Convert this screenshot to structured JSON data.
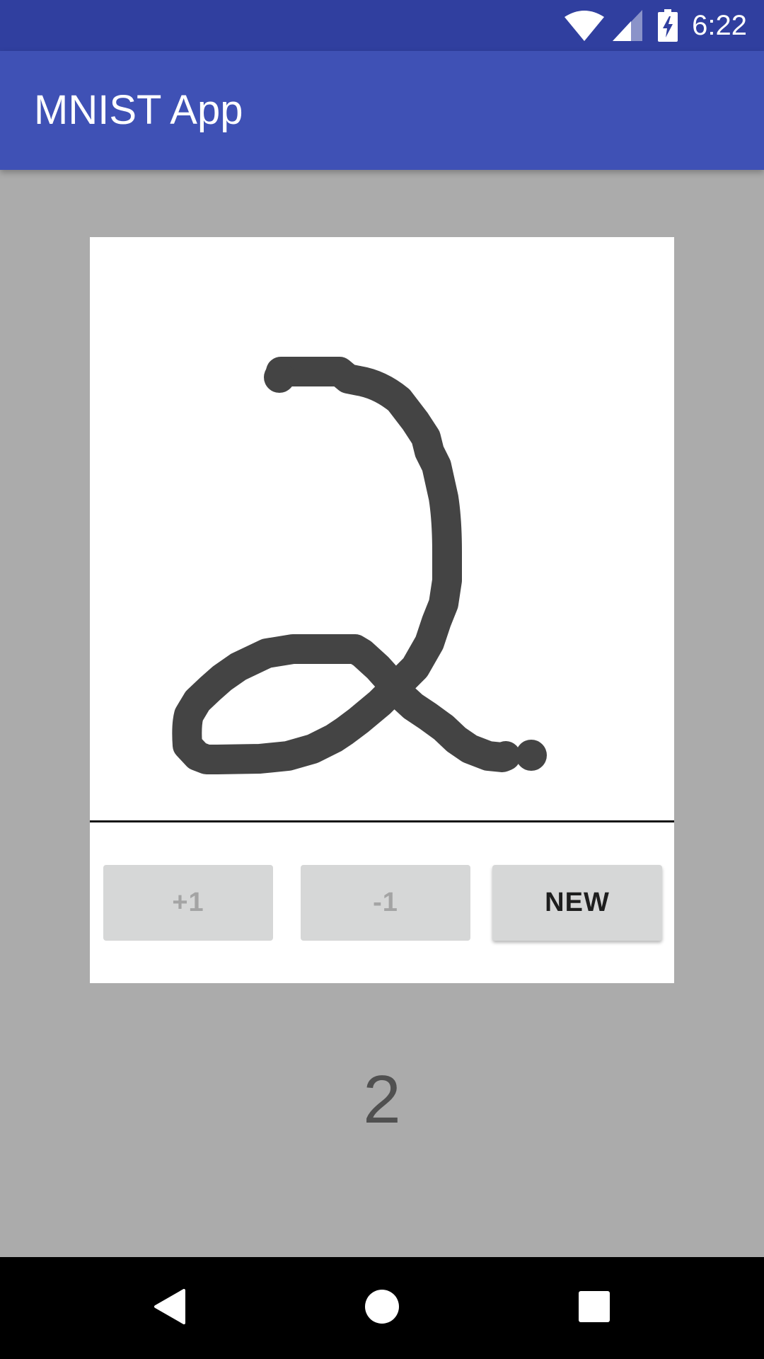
{
  "status_bar": {
    "time": "6:22",
    "icons": [
      "wifi-icon",
      "cell-signal-icon",
      "battery-charging-icon"
    ]
  },
  "app_bar": {
    "title": "MNIST App"
  },
  "drawing_canvas": {
    "content": "handwritten digit drawing",
    "stroke_color": "#444444",
    "background_color": "#ffffff"
  },
  "buttons": {
    "plus_one": "+1",
    "minus_one": "-1",
    "new": "NEW"
  },
  "prediction": {
    "digit": "2"
  },
  "nav_bar": {
    "icons": [
      "back-icon",
      "home-icon",
      "recents-icon"
    ]
  },
  "colors": {
    "status_bar": "#303f9f",
    "app_bar": "#3f51b5",
    "background": "#ababab",
    "button": "#d6d7d7"
  }
}
